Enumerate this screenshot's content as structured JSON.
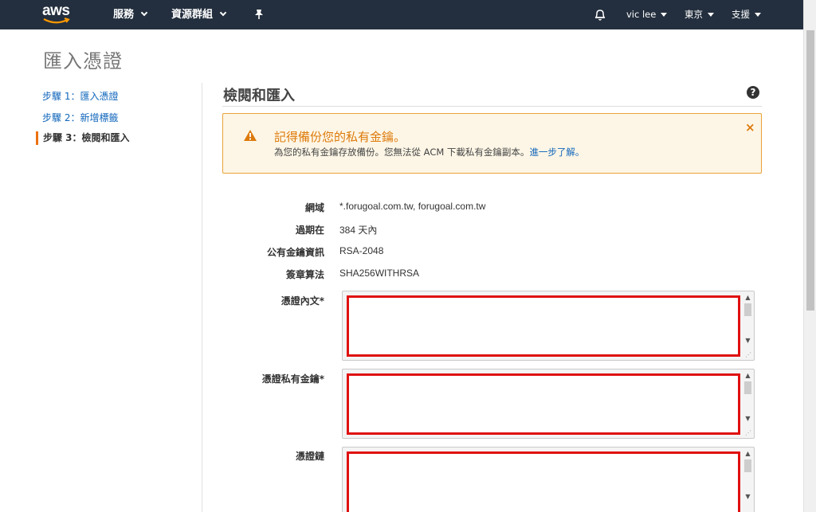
{
  "nav": {
    "logo_text": "aws",
    "services": "服務",
    "resource_groups": "資源群組",
    "user": "vic lee",
    "region": "東京",
    "support": "支援"
  },
  "page_title": "匯入憑證",
  "steps": [
    {
      "label": "步驟 1：匯入憑證"
    },
    {
      "label": "步驟 2：新增標籤"
    },
    {
      "label": "步驟 3：檢閱和匯入"
    }
  ],
  "section_title": "檢閱和匯入",
  "help_symbol": "?",
  "warning": {
    "title": "記得備份您的私有金鑰。",
    "body": "為您的私有金鑰存放備份。您無法從 ACM 下載私有金鑰副本。",
    "link": "進一步了解。",
    "close": "×"
  },
  "details": [
    {
      "label": "網域",
      "value": "*.forugoal.com.tw, forugoal.com.tw"
    },
    {
      "label": "過期在",
      "value": "384 天內"
    },
    {
      "label": "公有金鑰資訊",
      "value": "RSA-2048"
    },
    {
      "label": "簽章算法",
      "value": "SHA256WITHRSA"
    }
  ],
  "fields": [
    {
      "label": "憑證內文*",
      "value": ""
    },
    {
      "label": "憑證私有金鑰*",
      "value": ""
    },
    {
      "label": "憑證鏈",
      "value": ""
    }
  ],
  "colors": {
    "nav_bg": "#232f3e",
    "accent": "#ec7211",
    "warning_text": "#dd7a0b",
    "link": "#1166bb",
    "highlight_red": "#e01010"
  }
}
